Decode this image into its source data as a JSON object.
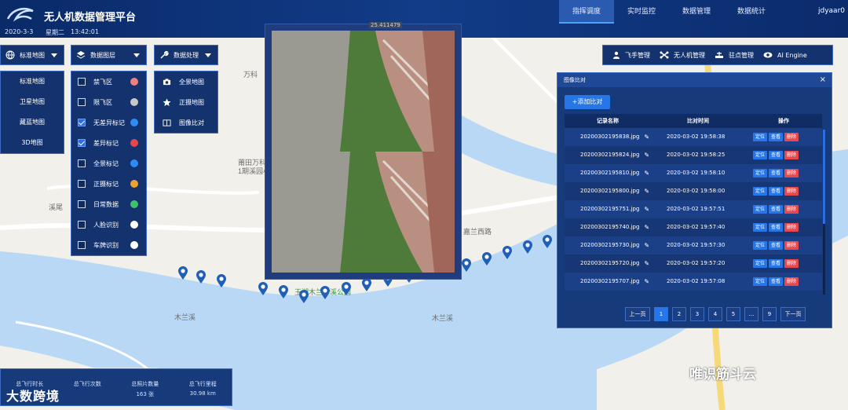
{
  "header": {
    "app_title": "无人机数据管理平台",
    "date": "2020-3-3",
    "weekday": "星期二",
    "time": "13:42:01",
    "user": "jdyaar0",
    "nav_tabs": [
      {
        "label": "指挥调度",
        "active": true
      },
      {
        "label": "实时监控",
        "active": false
      },
      {
        "label": "数据管理",
        "active": false
      },
      {
        "label": "数据统计",
        "active": false
      }
    ]
  },
  "toolbar": {
    "basemap_label": "标准地图",
    "layers_label": "数据图层",
    "process_label": "数据处理"
  },
  "basemaps": [
    "标准地图",
    "卫星地图",
    "藏蓝地图",
    "3D地图"
  ],
  "layers": [
    {
      "label": "禁飞区",
      "checked": false,
      "icon_color": "#f08080"
    },
    {
      "label": "限飞区",
      "checked": false,
      "icon_color": "#c8c8c8"
    },
    {
      "label": "无差异标记",
      "checked": true,
      "icon_color": "#2d8cf0"
    },
    {
      "label": "差异标记",
      "checked": true,
      "icon_color": "#e5484d"
    },
    {
      "label": "全景标记",
      "checked": false,
      "icon_color": "#2d8cf0"
    },
    {
      "label": "正摄标记",
      "checked": false,
      "icon_color": "#f0a030"
    },
    {
      "label": "日常数据",
      "checked": false,
      "icon_color": "#3fbf6f"
    },
    {
      "label": "人脸识别",
      "checked": false,
      "icon_color": "#ffffff"
    },
    {
      "label": "车牌识别",
      "checked": false,
      "icon_color": "#ffffff"
    }
  ],
  "process": [
    "全景地图",
    "正摄地图",
    "图像比对"
  ],
  "viewer": {
    "coord_text": "25.411479"
  },
  "management": [
    "飞手管理",
    "无人机管理",
    "驻点管理",
    "AI Engine"
  ],
  "compare": {
    "title": "图像比对",
    "add_label": "添加比对",
    "headers": [
      "记录名称",
      "比对时间",
      "操作"
    ],
    "rows": [
      {
        "name": "20200302195838.jpg",
        "time": "2020-03-02 19:58:38"
      },
      {
        "name": "20200302195824.jpg",
        "time": "2020-03-02 19:58:25"
      },
      {
        "name": "20200302195810.jpg",
        "time": "2020-03-02 19:58:10"
      },
      {
        "name": "20200302195800.jpg",
        "time": "2020-03-02 19:58:00"
      },
      {
        "name": "20200302195751.jpg",
        "time": "2020-03-02 19:57:51"
      },
      {
        "name": "20200302195740.jpg",
        "time": "2020-03-02 19:57:40"
      },
      {
        "name": "20200302195730.jpg",
        "time": "2020-03-02 19:57:30"
      },
      {
        "name": "20200302195720.jpg",
        "time": "2020-03-02 19:57:20"
      },
      {
        "name": "20200302195707.jpg",
        "time": "2020-03-02 19:57:08"
      }
    ],
    "actions": {
      "locate": "定位",
      "view": "查看",
      "delete": "删除"
    },
    "pager": {
      "prev": "上一页",
      "pages": [
        "1",
        "2",
        "3",
        "4",
        "5",
        "...",
        "9"
      ],
      "next": "下一页",
      "current": "1"
    }
  },
  "stats": [
    {
      "label": "总飞行时长",
      "value": ""
    },
    {
      "label": "总飞行次数",
      "value": ""
    },
    {
      "label": "总照片数量",
      "value": "163 张"
    },
    {
      "label": "总飞行里程",
      "value": "30.98 km"
    }
  ],
  "map_labels": {
    "road1": "嘉兰西路",
    "park": "玉湖木兰滨溪公园",
    "river1": "木兰溪",
    "river2": "木兰溪",
    "place1": "万科",
    "place2": "莆田万科",
    "place3": "1期溪园小",
    "place4": "溪尾"
  },
  "watermarks": {
    "left": "大数跨境",
    "right": "唯识筋斗云"
  }
}
